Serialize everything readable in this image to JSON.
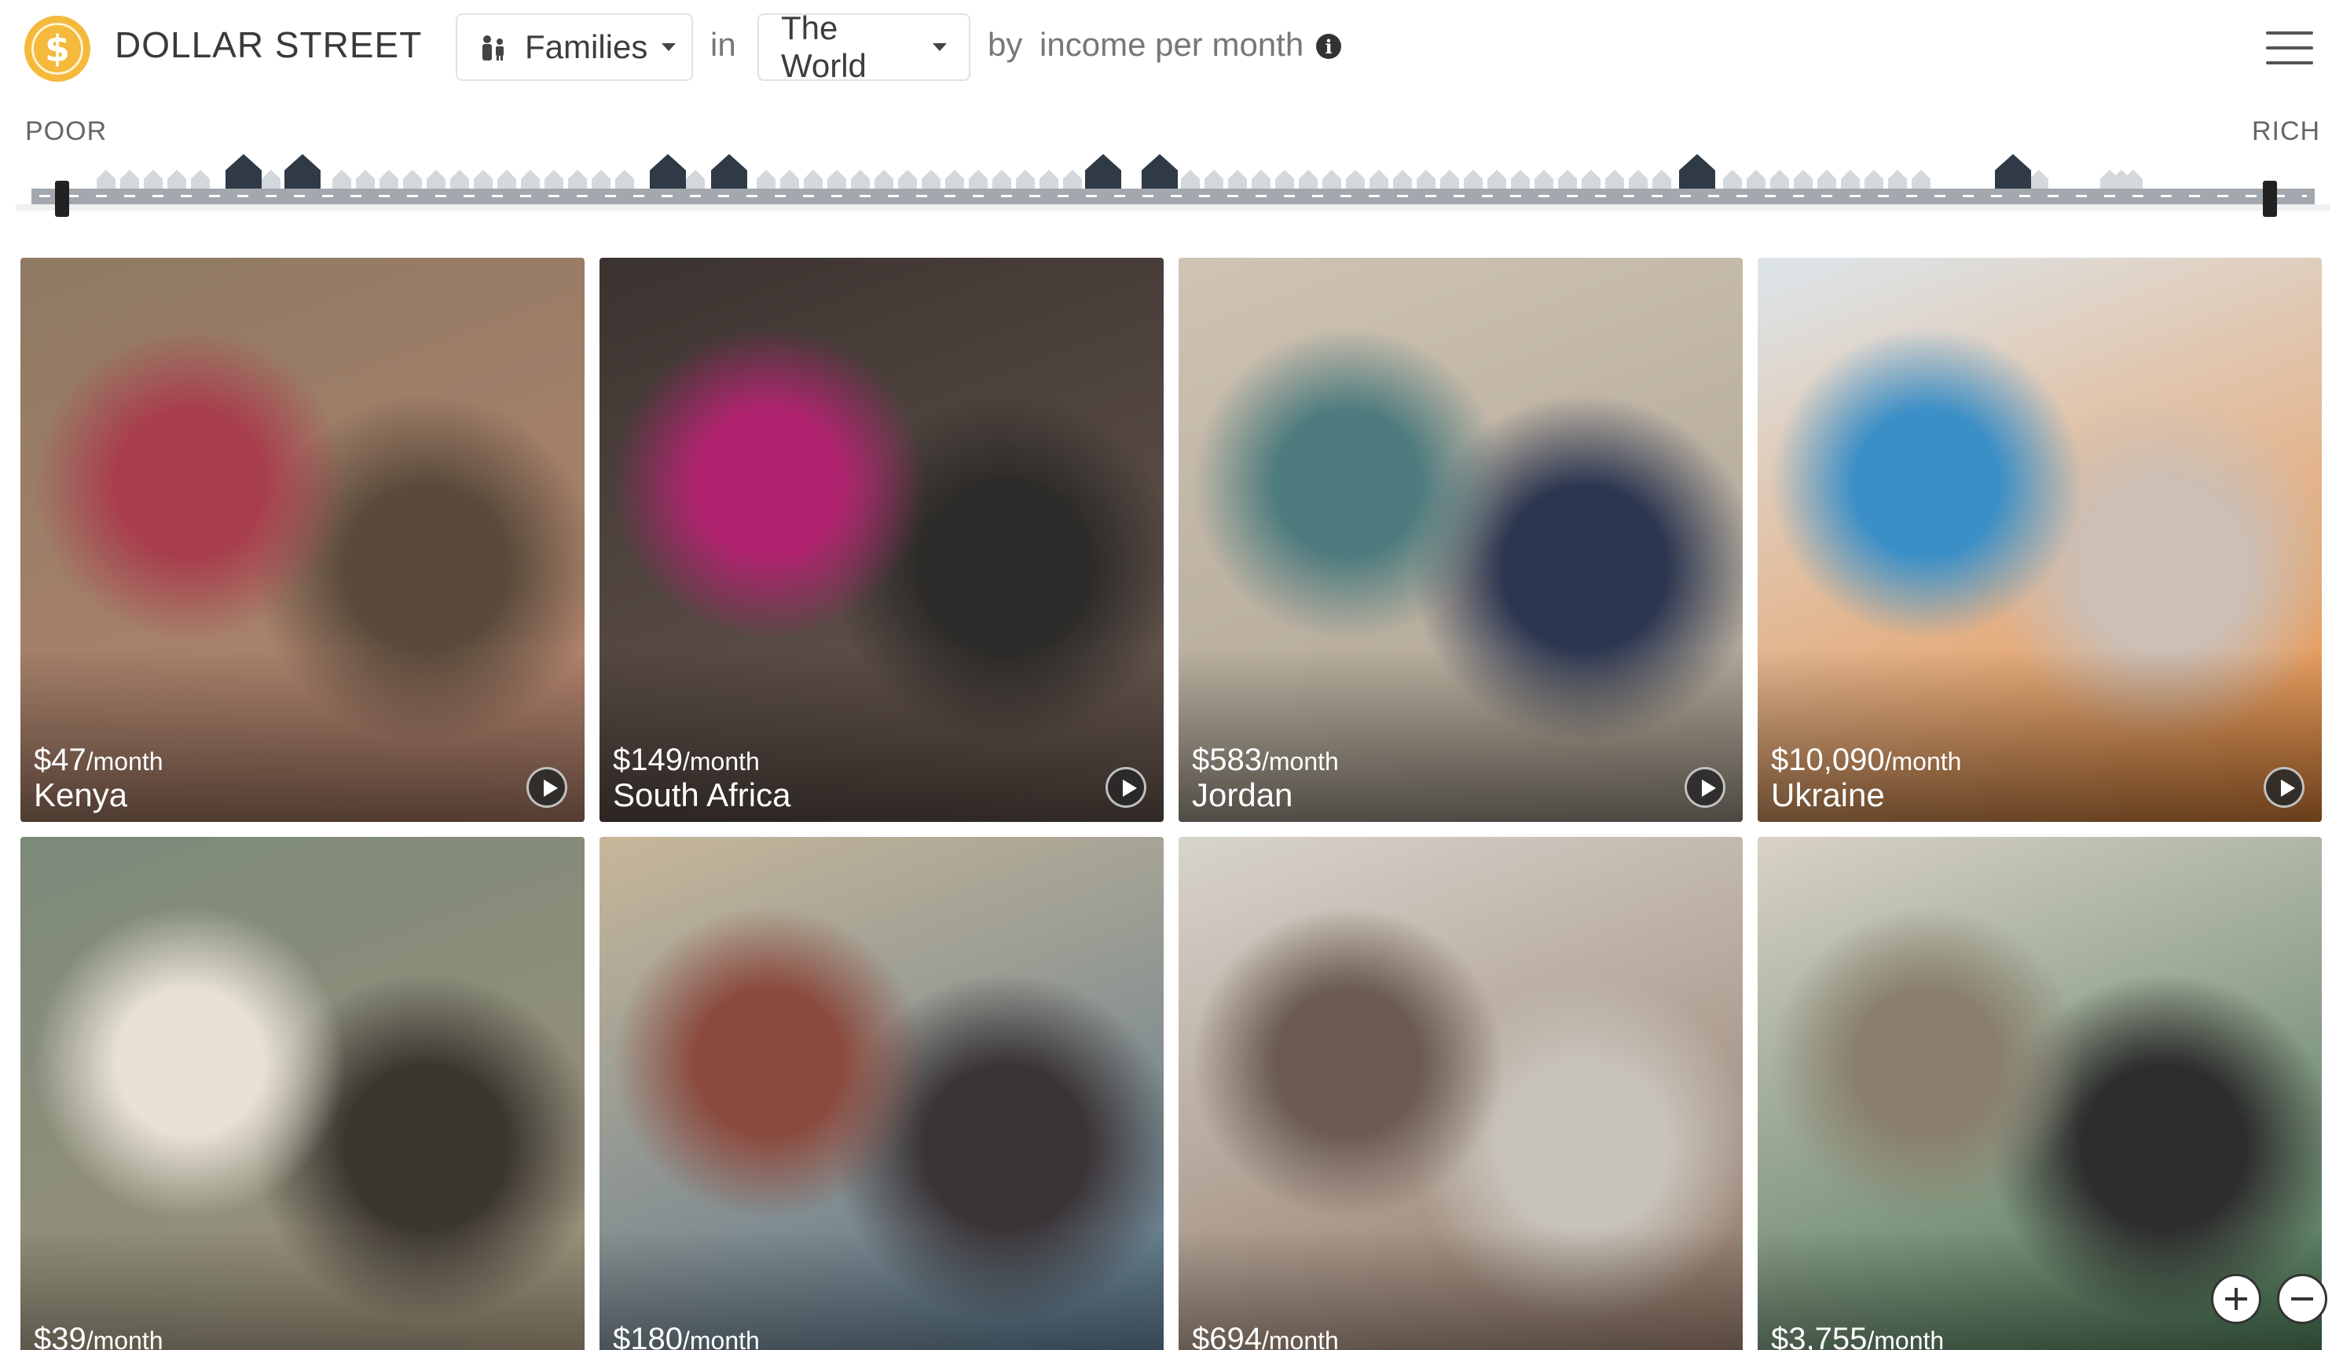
{
  "header": {
    "logo_symbol": "$",
    "brand": "DOLLAR STREET",
    "thing_dropdown": {
      "label": "Families",
      "icon": "family-icon"
    },
    "in_label": "in",
    "place_dropdown": {
      "label": "The World"
    },
    "by_label": "by",
    "sort_label": "income per month",
    "info_icon": "i",
    "menu_icon": "hamburger-menu-icon"
  },
  "income_strip": {
    "poor_label": "POOR",
    "rich_label": "RICH",
    "street_color": "#a2a8ae",
    "house_color_active": "#2f3a46",
    "house_color_inactive": "#d3d8dd"
  },
  "cards": [
    {
      "income": "$47",
      "unit": "/month",
      "country": "Kenya",
      "colors": [
        "#8e7a63",
        "#b8856f",
        "#a83d4c",
        "#5a4a3b"
      ]
    },
    {
      "income": "$149",
      "unit": "/month",
      "country": "South Africa",
      "colors": [
        "#3b3330",
        "#6d5b53",
        "#b0246f",
        "#2b2a28"
      ]
    },
    {
      "income": "$583",
      "unit": "/month",
      "country": "Jordan",
      "colors": [
        "#cfc4b3",
        "#a99f90",
        "#4e7b7e",
        "#2c3650"
      ]
    },
    {
      "income": "$10,090",
      "unit": "/month",
      "country": "Ukraine",
      "colors": [
        "#dde6ec",
        "#e88a3b",
        "#3b8fc7",
        "#cbbfb6"
      ]
    },
    {
      "income": "$39",
      "unit": "/month",
      "country": "",
      "colors": [
        "#7c8a7a",
        "#a1927a",
        "#e8e1d6",
        "#3c3631"
      ]
    },
    {
      "income": "$180",
      "unit": "/month",
      "country": "",
      "colors": [
        "#c7b79a",
        "#4e6f8a",
        "#8b4a3e",
        "#3a3437"
      ]
    },
    {
      "income": "$694",
      "unit": "/month",
      "country": "",
      "colors": [
        "#d8d4cc",
        "#8a6f5e",
        "#6b5b52",
        "#c8c3ba"
      ]
    },
    {
      "income": "$3,755",
      "unit": "/month",
      "country": "",
      "colors": [
        "#d9d2c5",
        "#3d6b4a",
        "#8a7f6f",
        "#2d2d2d"
      ]
    }
  ],
  "controls": {
    "zoom_in": "plus-icon",
    "zoom_out": "minus-icon"
  }
}
